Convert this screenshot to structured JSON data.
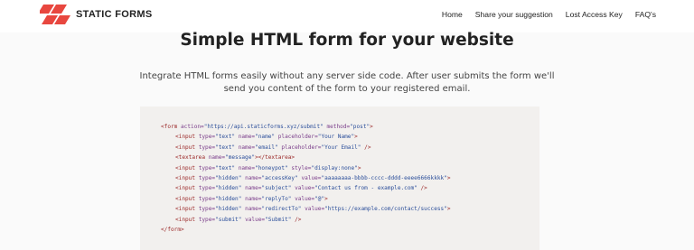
{
  "header": {
    "brand": "STATIC FORMS",
    "nav": [
      "Home",
      "Share your suggestion",
      "Lost Access Key",
      "FAQ's"
    ]
  },
  "hero": {
    "title": "Simple HTML form for your website",
    "description": "Integrate HTML forms easily without any server side code. After user submits the form we'll send you content of the form to your registered email."
  },
  "code_sample": {
    "lines": [
      {
        "indent": 0,
        "parts": [
          [
            "tag",
            "<form "
          ],
          [
            "attr",
            "action="
          ],
          [
            "str",
            "\"https://api.staticforms.xyz/submit\" "
          ],
          [
            "attr",
            "method="
          ],
          [
            "str",
            "\"post\""
          ],
          [
            "tag",
            ">"
          ]
        ]
      },
      {
        "indent": 1,
        "parts": [
          [
            "tag",
            "<input "
          ],
          [
            "attr",
            "type="
          ],
          [
            "str",
            "\"text\" "
          ],
          [
            "attr",
            "name="
          ],
          [
            "str",
            "\"name\" "
          ],
          [
            "attr",
            "placeholder="
          ],
          [
            "str",
            "\"Your Name\""
          ],
          [
            "tag",
            ">"
          ]
        ]
      },
      {
        "indent": 1,
        "parts": [
          [
            "tag",
            "<input "
          ],
          [
            "attr",
            "type="
          ],
          [
            "str",
            "\"text\" "
          ],
          [
            "attr",
            "name="
          ],
          [
            "str",
            "\"email\" "
          ],
          [
            "attr",
            "placeholder="
          ],
          [
            "str",
            "\"Your Email\" "
          ],
          [
            "tag",
            "/>"
          ]
        ]
      },
      {
        "indent": 1,
        "parts": [
          [
            "tag",
            "<textarea "
          ],
          [
            "attr",
            "name="
          ],
          [
            "str",
            "\"message\""
          ],
          [
            "tag",
            "></textarea>"
          ]
        ]
      },
      {
        "indent": 1,
        "parts": [
          [
            "tag",
            "<input "
          ],
          [
            "attr",
            "type="
          ],
          [
            "str",
            "\"text\" "
          ],
          [
            "attr",
            "name="
          ],
          [
            "str",
            "\"honeypot\" "
          ],
          [
            "attr",
            "style="
          ],
          [
            "str",
            "\"display:none\""
          ],
          [
            "tag",
            ">"
          ]
        ]
      },
      {
        "indent": 1,
        "parts": [
          [
            "tag",
            "<input "
          ],
          [
            "attr",
            "type="
          ],
          [
            "str",
            "\"hidden\" "
          ],
          [
            "attr",
            "name="
          ],
          [
            "str",
            "\"accessKey\" "
          ],
          [
            "attr",
            "value="
          ],
          [
            "str",
            "\"aaaaaaaa-bbbb-cccc-dddd-eeee6666kkkk\""
          ],
          [
            "tag",
            ">"
          ]
        ]
      },
      {
        "indent": 1,
        "parts": [
          [
            "tag",
            "<input "
          ],
          [
            "attr",
            "type="
          ],
          [
            "str",
            "\"hidden\" "
          ],
          [
            "attr",
            "name="
          ],
          [
            "str",
            "\"subject\" "
          ],
          [
            "attr",
            "value="
          ],
          [
            "str",
            "\"Contact us from - example.com\" "
          ],
          [
            "tag",
            "/>"
          ]
        ]
      },
      {
        "indent": 1,
        "parts": [
          [
            "tag",
            "<input "
          ],
          [
            "attr",
            "type="
          ],
          [
            "str",
            "\"hidden\" "
          ],
          [
            "attr",
            "name="
          ],
          [
            "str",
            "\"replyTo\" "
          ],
          [
            "attr",
            "value="
          ],
          [
            "str",
            "\"@\""
          ],
          [
            "tag",
            ">"
          ]
        ]
      },
      {
        "indent": 1,
        "parts": [
          [
            "tag",
            "<input "
          ],
          [
            "attr",
            "type="
          ],
          [
            "str",
            "\"hidden\" "
          ],
          [
            "attr",
            "name="
          ],
          [
            "str",
            "\"redirectTo\" "
          ],
          [
            "attr",
            "value="
          ],
          [
            "str",
            "\"https://example.com/contact/success\""
          ],
          [
            "tag",
            ">"
          ]
        ]
      },
      {
        "indent": 1,
        "parts": [
          [
            "tag",
            "<input "
          ],
          [
            "attr",
            "type="
          ],
          [
            "str",
            "\"submit\" "
          ],
          [
            "attr",
            "value="
          ],
          [
            "str",
            "\"Submit\" "
          ],
          [
            "tag",
            "/>"
          ]
        ]
      },
      {
        "indent": 0,
        "parts": [
          [
            "tag",
            "</form>"
          ]
        ]
      }
    ]
  },
  "colors": {
    "logo": "#e8473f",
    "tag": "#9b2828",
    "attr": "#7a3d8a",
    "string": "#2b4e9a",
    "code_bg": "#f2f0ee"
  },
  "icons": {
    "brand_logo": "staticforms-logo-icon"
  }
}
